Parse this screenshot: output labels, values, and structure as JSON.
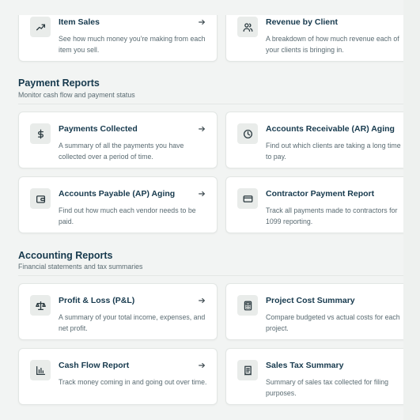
{
  "top_cards": [
    {
      "title": "Item Sales",
      "desc": "See how much money you're making from each item you sell.",
      "icon": "trending-up-icon",
      "arrow": true
    },
    {
      "title": "Revenue by Client",
      "desc": "A breakdown of how much revenue each of your clients is bringing in.",
      "icon": "users-icon",
      "arrow": false
    }
  ],
  "payment_section": {
    "title": "Payment Reports",
    "subtitle": "Monitor cash flow and payment status",
    "cards": [
      {
        "title": "Payments Collected",
        "desc": "A summary of all the payments you have collected over a period of time.",
        "icon": "dollar-icon",
        "arrow": true
      },
      {
        "title": "Accounts Receivable (AR) Aging",
        "desc": "Find out which clients are taking a long time to pay.",
        "icon": "clock-icon",
        "arrow": false
      },
      {
        "title": "Accounts Payable (AP) Aging",
        "desc": "Find out how much each vendor needs to be paid.",
        "icon": "wallet-icon",
        "arrow": true
      },
      {
        "title": "Contractor Payment Report",
        "desc": "Track all payments made to contractors for 1099 reporting.",
        "icon": "credit-card-icon",
        "arrow": false
      }
    ]
  },
  "accounting_section": {
    "title": "Accounting Reports",
    "subtitle": "Financial statements and tax summaries",
    "cards": [
      {
        "title": "Profit & Loss (P&L)",
        "desc": "A summary of your total income, expenses, and net profit.",
        "icon": "scale-icon",
        "arrow": true
      },
      {
        "title": "Project Cost Summary",
        "desc": "Compare budgeted vs actual costs for each project.",
        "icon": "calculator-icon",
        "arrow": false
      },
      {
        "title": "Cash Flow Report",
        "desc": "Track money coming in and going out over time.",
        "icon": "bar-chart-icon",
        "arrow": true
      },
      {
        "title": "Sales Tax Summary",
        "desc": "Summary of sales tax collected for filing purposes.",
        "icon": "receipt-icon",
        "arrow": false
      }
    ]
  },
  "colors": {
    "title": "#16394d",
    "text": "#5a6b72",
    "icon_bg": "#e9ecea",
    "page_bg": "#f2f4f3"
  }
}
